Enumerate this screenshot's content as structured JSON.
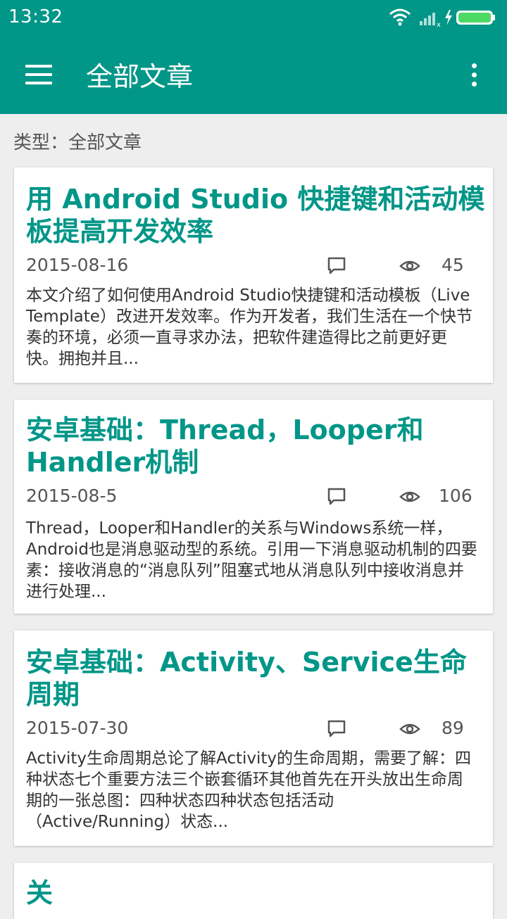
{
  "status_bar": {
    "time": "13:32"
  },
  "app_bar": {
    "title": "全部文章"
  },
  "filter_label": "类型：全部文章",
  "articles": [
    {
      "title": "用 Android Studio 快捷键和活动模板提高开发效率",
      "date": "2015-08-16",
      "views": "45",
      "excerpt": "本文介绍了如何使用Android Studio快捷键和活动模板（Live Template）改进开发效率。作为开发者，我们生活在一个快节奏的环境，必须一直寻求办法，把软件建造得比之前更好更快。拥抱并且..."
    },
    {
      "title": "安卓基础：Thread，Looper和Handler机制",
      "date": "2015-08-5",
      "views": "106",
      "excerpt": "Thread，Looper和Handler的关系与Windows系统一样，Android也是消息驱动型的系统。引用一下消息驱动机制的四要素：接收消息的“消息队列”阻塞式地从消息队列中接收消息并进行处理..."
    },
    {
      "title": "安卓基础：Activity、Service生命周期",
      "date": "2015-07-30",
      "views": "89",
      "excerpt": "Activity生命周期总论了解Activity的生命周期，需要了解：四种状态七个重要方法三个嵌套循环其他首先在开头放出生命周期的一张总图：四种状态四种状态包括活动（Active/Running）状态..."
    },
    {
      "title": "关"
    }
  ],
  "colors": {
    "primary": "#009688",
    "background": "#eeeeee",
    "card": "#ffffff"
  }
}
